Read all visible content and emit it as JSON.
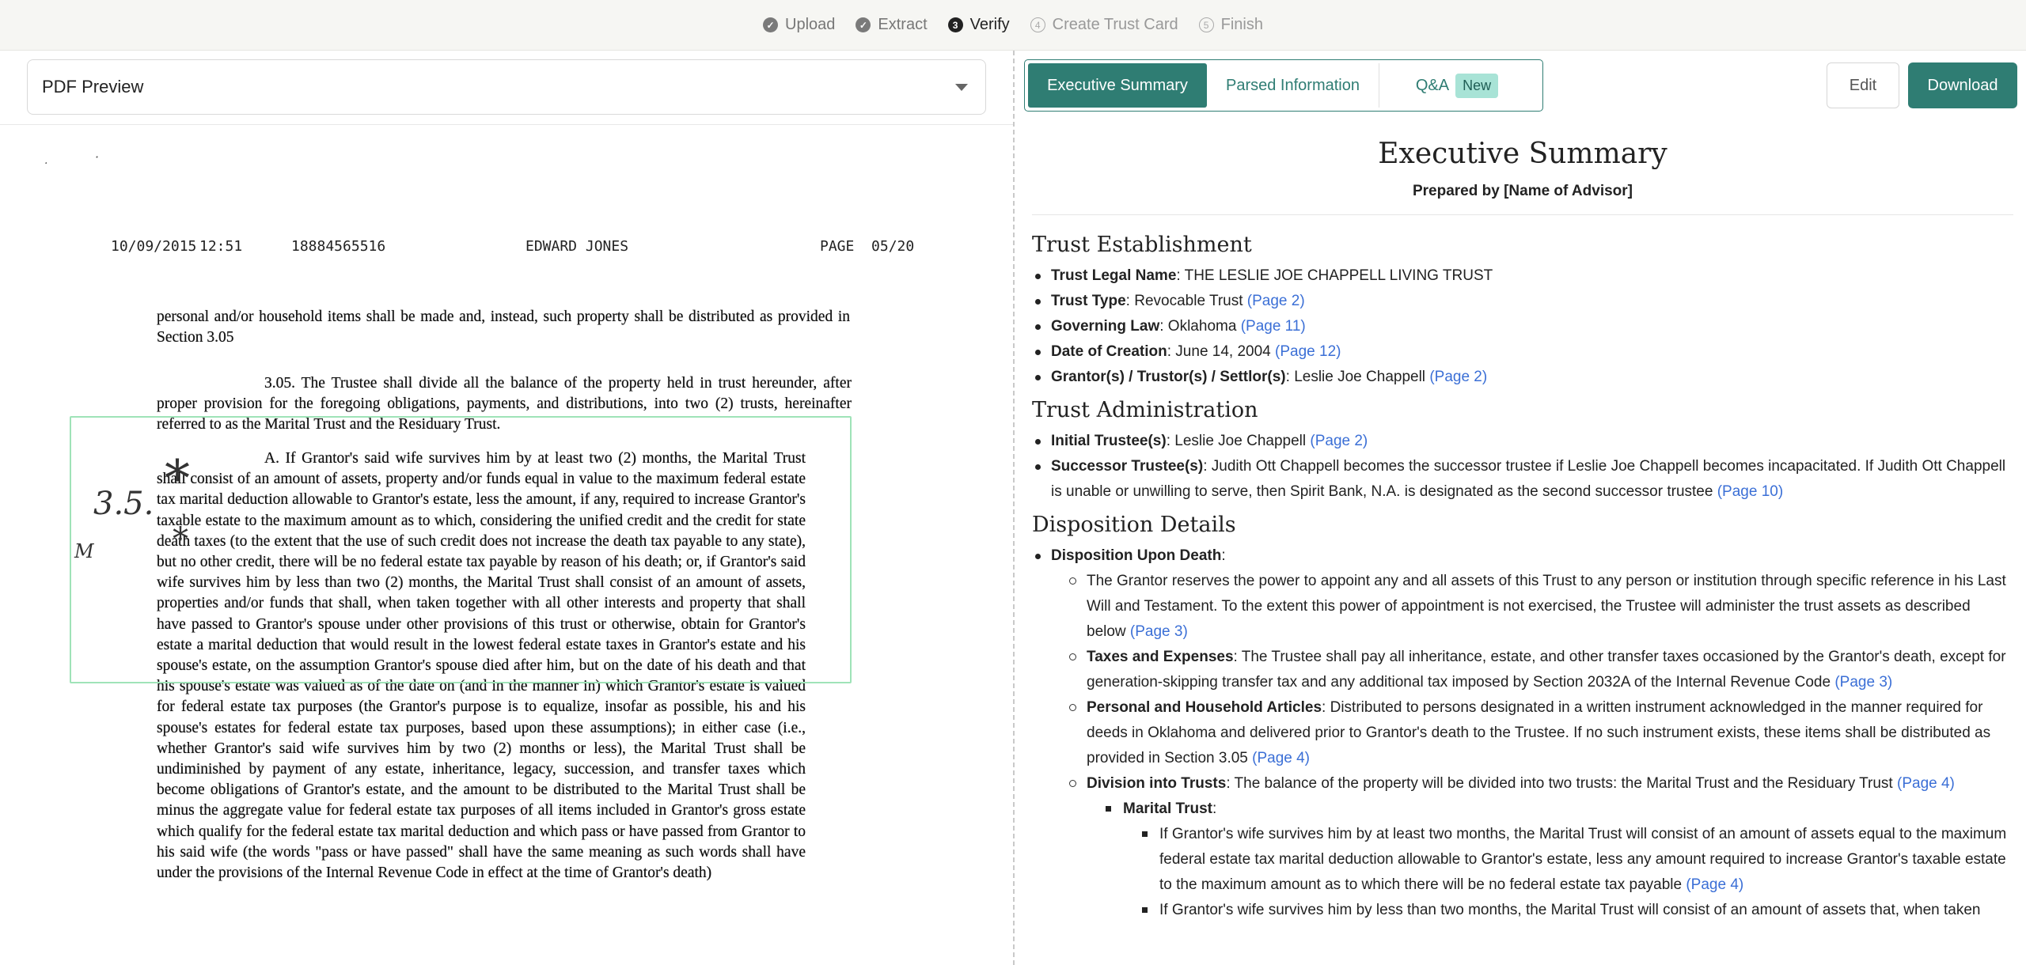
{
  "steps": [
    {
      "label": "Upload",
      "state": "done",
      "num": "✓"
    },
    {
      "label": "Extract",
      "state": "done",
      "num": "✓"
    },
    {
      "label": "Verify",
      "state": "active",
      "num": "3"
    },
    {
      "label": "Create Trust Card",
      "state": "todo",
      "num": "4"
    },
    {
      "label": "Finish",
      "state": "todo",
      "num": "5"
    }
  ],
  "pdf": {
    "dropdown_label": "PDF Preview",
    "fax_date": "10/09/2015",
    "fax_time": "12:51",
    "fax_number": "18884565516",
    "fax_sender": "EDWARD JONES",
    "fax_page": "PAGE  05/20",
    "margin_note": "3.5.",
    "margin_mark": "*",
    "margin_initials": "M",
    "text_p1": "personal and/or household items shall be made and, instead, such property shall be distributed as provided in Section 3.05",
    "text_p2": "3.05. The Trustee shall divide all the balance of the property held in trust hereunder, after proper provision for the foregoing obligations, payments, and distributions, into two (2) trusts, hereinafter referred to as the Marital Trust and the Residuary Trust.",
    "text_p3": "A. If Grantor's said wife survives him by at least two (2) months, the Marital Trust shall consist of an amount of assets, property and/or funds equal in value to the maximum federal estate tax marital deduction allowable to Grantor's estate, less the amount, if any, required to increase Grantor's taxable estate to the maximum amount as to which, considering the unified credit and the credit for state death taxes (to the extent that the use of such credit does not increase the death tax payable to any state), but no other credit, there will be no federal estate tax payable by reason of his death; or, if Grantor's said wife survives him by less than two (2) months, the Marital Trust shall consist of an amount of assets, properties and/or funds that shall, when taken together with all other interests and property that shall have passed to Grantor's spouse under other provisions of this trust or otherwise, obtain for Grantor's estate a marital deduction that would result in the lowest federal estate taxes in Grantor's estate and his spouse's estate, on the assumption Grantor's spouse died after him, but on the date of his death and that his spouse's estate was valued as of the date on (and in the manner in) which Grantor's estate is valued for federal estate tax purposes (the Grantor's purpose is to equalize, insofar as possible, his and his spouse's estates for federal estate tax purposes, based upon these assumptions); in either case (i.e., whether Grantor's said wife survives him by two (2) months or less), the Marital Trust shall be undiminished by payment of any estate, inheritance, legacy, succession, and transfer taxes which become obligations of Grantor's estate, and the amount to be distributed to the Marital Trust shall be minus the aggregate value for federal estate tax purposes of all items included in Grantor's gross estate which qualify for the federal estate tax marital deduction and which pass or have passed from Grantor to his said wife (the words \"pass or have passed\" shall have the same meaning as such words shall have under the provisions of the Internal Revenue Code in effect at the time of Grantor's death)"
  },
  "tabs": {
    "executive_summary": "Executive Summary",
    "parsed_information": "Parsed Information",
    "qa": "Q&A",
    "qa_badge": "New"
  },
  "actions": {
    "edit": "Edit",
    "download": "Download"
  },
  "summary": {
    "title": "Executive Summary",
    "prepared_by": "Prepared by [Name of Advisor]",
    "trust_establishment": {
      "heading": "Trust Establishment",
      "legal_name_label": "Trust Legal Name",
      "legal_name_value": ": THE LESLIE JOE CHAPPELL LIVING TRUST",
      "type_label": "Trust Type",
      "type_value": ": Revocable Trust ",
      "type_page": "(Page 2)",
      "law_label": "Governing Law",
      "law_value": ": Oklahoma ",
      "law_page": "(Page 11)",
      "date_label": "Date of Creation",
      "date_value": ": June 14, 2004 ",
      "date_page": "(Page 12)",
      "grantor_label": "Grantor(s) / Trustor(s) / Settlor(s)",
      "grantor_value": ": Leslie Joe Chappell ",
      "grantor_page": "(Page 2)"
    },
    "trust_administration": {
      "heading": "Trust Administration",
      "initial_label": "Initial Trustee(s)",
      "initial_value": ": Leslie Joe Chappell ",
      "initial_page": "(Page 2)",
      "successor_label": "Successor Trustee(s)",
      "successor_value": ": Judith Ott Chappell becomes the successor trustee if Leslie Joe Chappell becomes incapacitated. If Judith Ott Chappell is unable or unwilling to serve, then Spirit Bank, N.A. is designated as the second successor trustee ",
      "successor_page": "(Page 10)"
    },
    "disposition": {
      "heading": "Disposition Details",
      "upon_death_label": "Disposition Upon Death",
      "upon_death_colon": ":",
      "item1_text": "The Grantor reserves the power to appoint any and all assets of this Trust to any person or institution through specific reference in his Last Will and Testament. To the extent this power of appointment is not exercised, the Trustee will administer the trust assets as described below ",
      "item1_page": "(Page 3)",
      "taxes_label": "Taxes and Expenses",
      "taxes_value": ": The Trustee shall pay all inheritance, estate, and other transfer taxes occasioned by the Grantor's death, except for generation-skipping transfer tax and any additional tax imposed by Section 2032A of the Internal Revenue Code ",
      "taxes_page": "(Page 3)",
      "articles_label": "Personal and Household Articles",
      "articles_value": ": Distributed to persons designated in a written instrument acknowledged in the manner required for deeds in Oklahoma and delivered prior to Grantor's death to the Trustee. If no such instrument exists, these items shall be distributed as provided in Section 3.05 ",
      "articles_page": "(Page 4)",
      "division_label": "Division into Trusts",
      "division_value": ": The balance of the property will be divided into two trusts: the Marital Trust and the Residuary Trust ",
      "division_page": "(Page 4)",
      "marital_label": "Marital Trust",
      "marital_colon": ":",
      "marital_1": "If Grantor's wife survives him by at least two months, the Marital Trust will consist of an amount of assets equal to the maximum federal estate tax marital deduction allowable to Grantor's estate, less any amount required to increase Grantor's taxable estate to the maximum amount as to which there will be no federal estate tax payable ",
      "marital_1_page": "(Page 4)",
      "marital_2": "If Grantor's wife survives him by less than two months, the Marital Trust will consist of an amount of assets that, when taken"
    }
  },
  "colors": {
    "accent": "#2f7d73",
    "badge": "#a8e3d6",
    "page_link": "#3b6fd6",
    "highlight": "#9fe3b8"
  }
}
